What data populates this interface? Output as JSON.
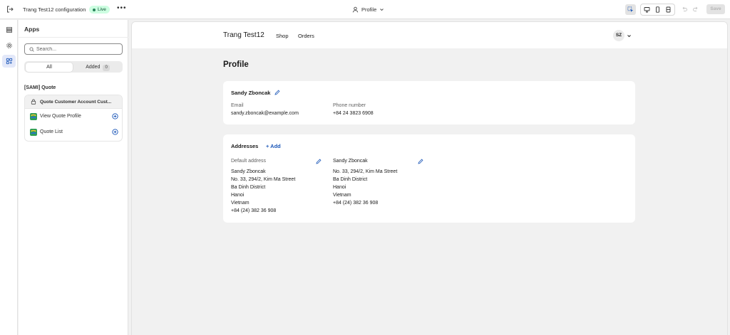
{
  "topbar": {
    "title": "Trang Test12 configuration",
    "status_badge": "Live",
    "more_label": "•••",
    "page_selector": "Profile",
    "save_label": "Save"
  },
  "panel": {
    "title": "Apps",
    "search_placeholder": "Search...",
    "tabs": {
      "all": "All",
      "added": "Added",
      "added_count": "0"
    },
    "group_title": "[SAMI] Quote",
    "card_header": "Quote Customer Account Cust...",
    "apps": [
      {
        "label": "View Quote Profile"
      },
      {
        "label": "Quote List"
      }
    ]
  },
  "store": {
    "name": "Trang Test12",
    "nav": {
      "shop": "Shop",
      "orders": "Orders"
    },
    "avatar_initials": "SZ"
  },
  "profile": {
    "page_title": "Profile",
    "name": "Sandy Zboncak",
    "email_label": "Email",
    "email_value": "sandy.zboncak@example.com",
    "phone_label": "Phone number",
    "phone_value": "+84 24 3823 6908"
  },
  "addresses": {
    "heading": "Addresses",
    "add_label": "+ Add",
    "default_label": "Default address",
    "default_lines": [
      "Sandy Zboncak",
      "No. 33, 294/2, Kim Ma Street",
      "Ba Dinh District",
      "Hanoi",
      "Vietnam",
      "+84 (24) 382 36 908"
    ],
    "second_lines": [
      "Sandy Zboncak",
      "No. 33, 294/2, Kim Ma Street",
      "Ba Dinh District",
      "Hanoi",
      "Vietnam",
      "+84 (24) 382 36 908"
    ]
  },
  "colors": {
    "accent": "#1a56b8",
    "live_badge_bg": "#cdfee1",
    "live_badge_text": "#0c5132"
  }
}
